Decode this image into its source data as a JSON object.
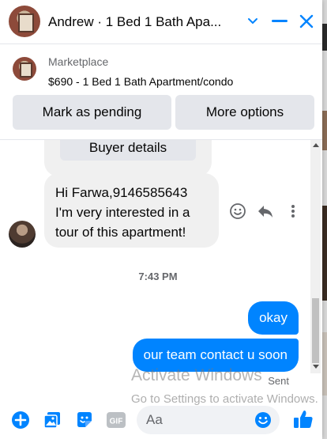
{
  "header": {
    "title": "Andrew · 1 Bed 1 Bath Apa...",
    "chevron_icon": "chevron-down-icon",
    "minimize_icon": "minimize-icon",
    "close_icon": "close-icon"
  },
  "marketplace": {
    "label": "Marketplace",
    "listing": "$690 - 1 Bed 1 Bath Apartment/condo"
  },
  "actions": {
    "mark_pending": "Mark as pending",
    "more_options": "More options"
  },
  "buyer_card": {
    "button_label": "Buyer details"
  },
  "messages": {
    "received_text": "Hi Farwa,9146585643\nI'm very interested in a\ntour of this apartment!",
    "timestamp": "7:43 PM",
    "sent": [
      "okay",
      "our team contact u soon"
    ],
    "status": "Sent"
  },
  "watermark": {
    "title": "Activate Windows",
    "subtitle": "Go to Settings to activate Windows."
  },
  "composer": {
    "placeholder": "Aa",
    "gif_label": "GIF"
  },
  "colors": {
    "accent": "#0084ff",
    "bubble_gray": "#f0f0f0",
    "button_gray": "#e4e6eb"
  }
}
